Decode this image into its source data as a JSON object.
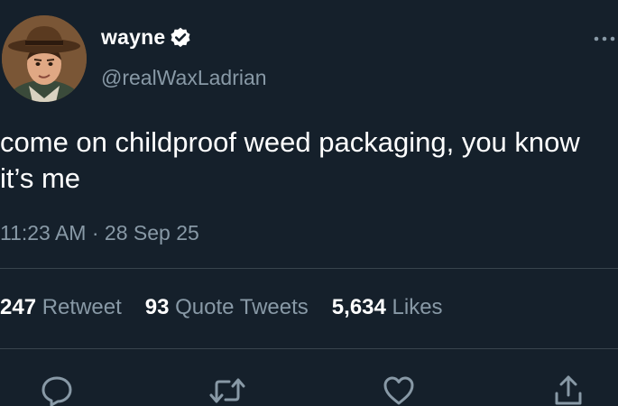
{
  "user": {
    "display_name": "wayne",
    "handle": "@realWaxLadrian",
    "avatar_icon": "avatar-cowboy-hat-portrait",
    "verified_icon": "verified-badge-icon"
  },
  "tweet": {
    "text": "come on childproof weed packaging, you know it’s me",
    "timestamp": "11:23 AM · 28 Sep 25"
  },
  "stats": {
    "retweets": {
      "count": "247",
      "label": "Retweet"
    },
    "quote_tweets": {
      "count": "93",
      "label": "Quote Tweets"
    },
    "likes": {
      "count": "5,634",
      "label": "Likes"
    }
  },
  "actions": [
    "reply-icon",
    "retweet-icon",
    "like-icon",
    "share-icon"
  ],
  "colors": {
    "background": "#15202b",
    "primary_text": "#ffffff",
    "secondary_text": "#8899a6",
    "divider": "#38444d"
  }
}
